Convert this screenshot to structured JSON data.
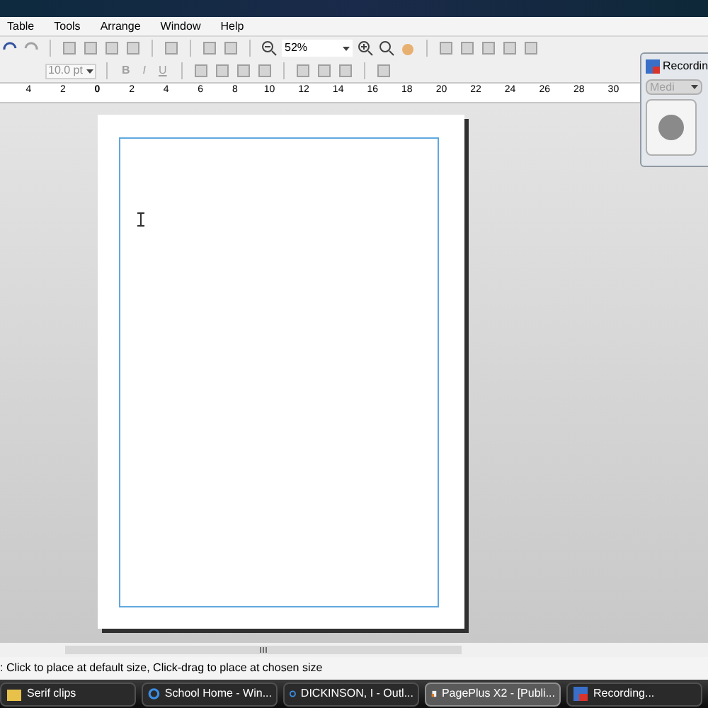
{
  "menu": [
    {
      "label": "Table"
    },
    {
      "label": "Tools"
    },
    {
      "label": "Arrange"
    },
    {
      "label": "Window"
    },
    {
      "label": "Help"
    }
  ],
  "toolbar": {
    "zoom": "52%",
    "font_size": "10.0 pt",
    "bold": "B",
    "italic": "I",
    "underline": "U"
  },
  "ruler": [
    "4",
    "2",
    "0",
    "2",
    "4",
    "6",
    "8",
    "10",
    "12",
    "14",
    "16",
    "18",
    "20",
    "22",
    "24",
    "26",
    "28",
    "30"
  ],
  "recording_panel": {
    "title": "Recordin",
    "dropdown": "Medi"
  },
  "status_bar": ": Click to place at default size, Click-drag to place at chosen size",
  "taskbar": [
    {
      "label": "Serif clips",
      "kind": "folder",
      "selected": false
    },
    {
      "label": "School Home - Win...",
      "kind": "browser",
      "selected": false
    },
    {
      "label": "DICKINSON, I - Outl...",
      "kind": "browser",
      "selected": false
    },
    {
      "label": "PagePlus X2 - [Publi...",
      "kind": "document",
      "selected": true
    },
    {
      "label": "Recording...",
      "kind": "recorder",
      "selected": false
    }
  ]
}
